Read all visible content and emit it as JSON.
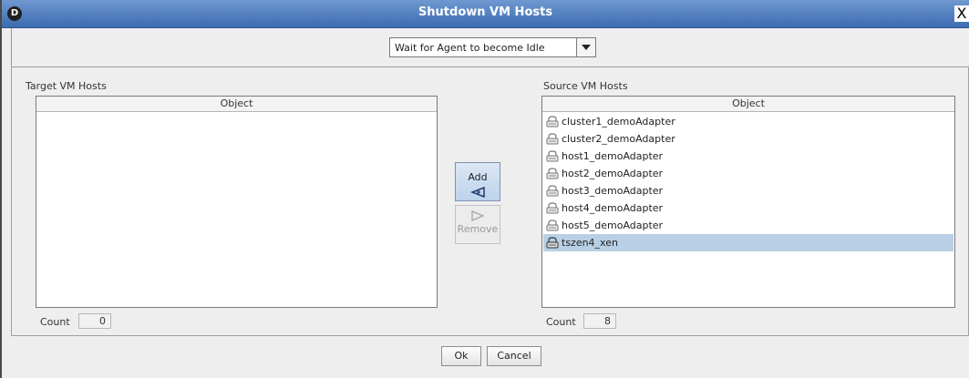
{
  "window": {
    "title": "Shutdown VM Hosts",
    "logo": "D",
    "close": "X"
  },
  "mode": {
    "selected": "Wait for Agent to become Idle"
  },
  "target": {
    "label": "Target VM Hosts",
    "column": "Object",
    "count_label": "Count",
    "count": "0"
  },
  "source": {
    "label": "Source VM Hosts",
    "column": "Object",
    "count_label": "Count",
    "count": "8",
    "items": [
      "cluster1_demoAdapter",
      "cluster2_demoAdapter",
      "host1_demoAdapter",
      "host2_demoAdapter",
      "host3_demoAdapter",
      "host4_demoAdapter",
      "host5_demoAdapter",
      "tszen4_xen"
    ],
    "selected_index": 7
  },
  "actions": {
    "add": "Add",
    "remove": "Remove"
  },
  "footer": {
    "ok": "Ok",
    "cancel": "Cancel"
  },
  "colors": {
    "titlebar": "#4a7bbf",
    "selection": "#b8cfe5",
    "add_button": "#c8daf0"
  }
}
